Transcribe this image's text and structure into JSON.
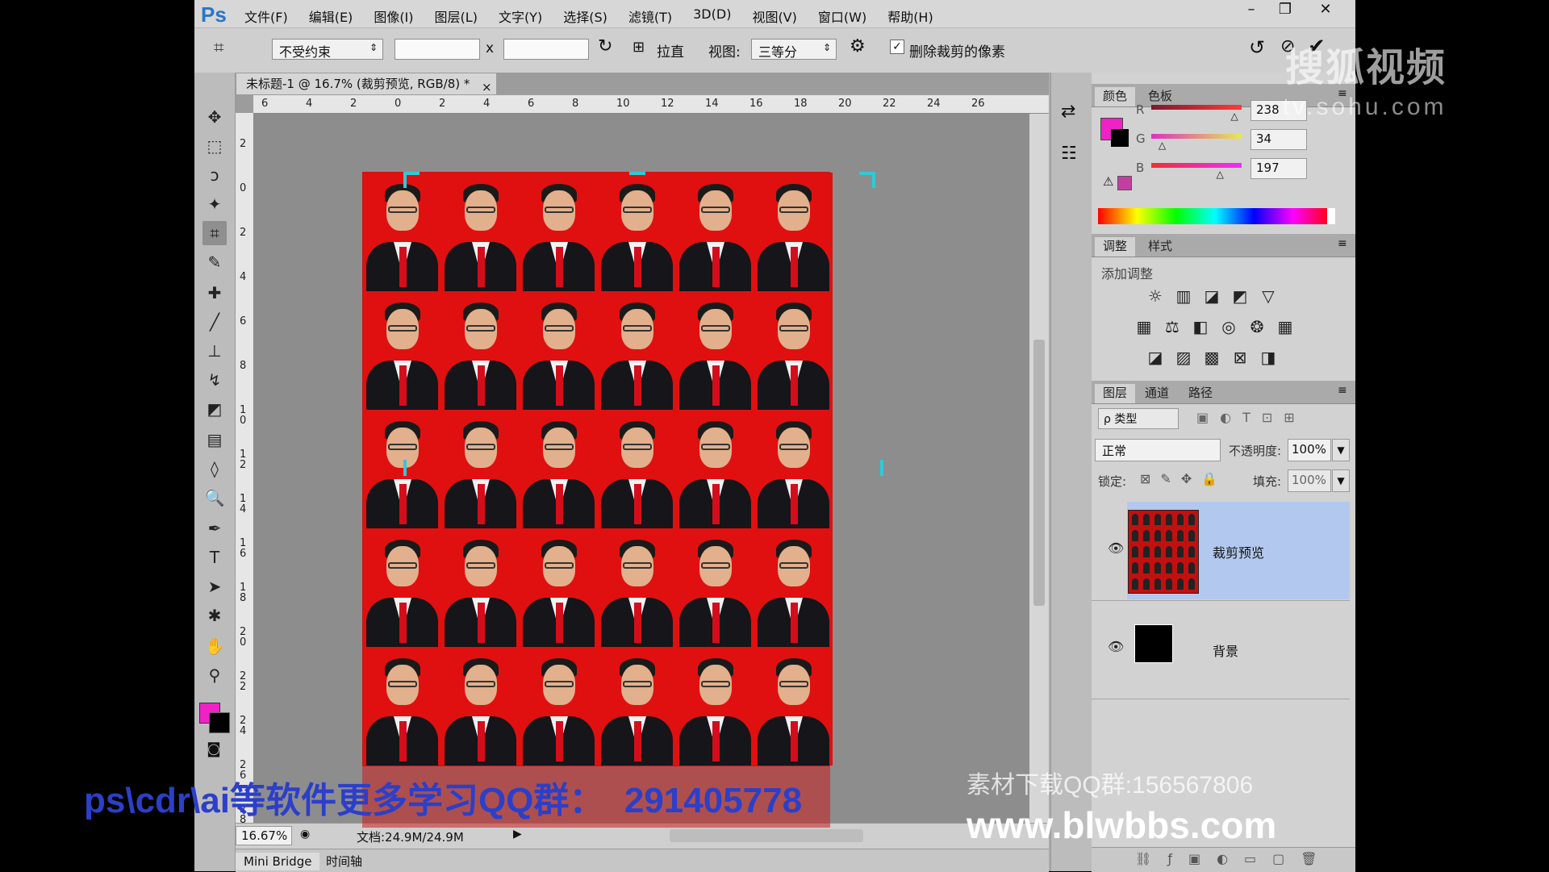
{
  "menu": {
    "logo": "Ps",
    "items": [
      "文件(F)",
      "编辑(E)",
      "图像(I)",
      "图层(L)",
      "文字(Y)",
      "选择(S)",
      "滤镜(T)",
      "3D(D)",
      "视图(V)",
      "窗口(W)",
      "帮助(H)"
    ]
  },
  "window_controls": {
    "minimize": "–",
    "restore": "❐",
    "close": "✕"
  },
  "options": {
    "ratio_select": "不受约束",
    "width_value": "",
    "times": "x",
    "height_value": "",
    "straighten": "拉直",
    "view_label": "视图:",
    "view_select": "三等分",
    "delete_pixels_label": "删除裁剪的像素",
    "delete_pixels_checked": true
  },
  "document": {
    "tab_title": "未标题-1 @ 16.7% (裁剪预览, RGB/8) *",
    "close": "×",
    "ruler_top": [
      "6",
      "4",
      "2",
      "0",
      "2",
      "4",
      "6",
      "8",
      "10",
      "12",
      "14",
      "16",
      "18",
      "20",
      "22",
      "24",
      "26"
    ],
    "ruler_left": [
      "2",
      "0",
      "2",
      "4",
      "6",
      "8",
      "10",
      "12",
      "14",
      "16",
      "18",
      "20",
      "22",
      "24",
      "26",
      "28"
    ],
    "zoom": "16.67%",
    "doc_info": "文档:24.9M/24.9M",
    "bottom_tabs": [
      "Mini Bridge",
      "时间轴"
    ]
  },
  "color_panel": {
    "tabs": [
      "颜色",
      "色板"
    ],
    "foreground": "#ee22c5",
    "background": "#000000",
    "channels": [
      {
        "label": "R",
        "value": "238",
        "fraction": 0.933
      },
      {
        "label": "G",
        "value": "34",
        "fraction": 0.133
      },
      {
        "label": "B",
        "value": "197",
        "fraction": 0.773
      }
    ]
  },
  "adjustments_panel": {
    "tabs": [
      "调整",
      "样式"
    ],
    "title": "添加调整"
  },
  "layers_panel": {
    "tabs": [
      "图层",
      "通道",
      "路径"
    ],
    "filter_label": "ρ 类型",
    "blend_mode": "正常",
    "opacity_label": "不透明度:",
    "opacity_value": "100%",
    "lock_label": "锁定:",
    "fill_label": "填充:",
    "fill_value": "100%",
    "layers": [
      {
        "name": "裁剪预览",
        "selected": true
      },
      {
        "name": "背景",
        "selected": false
      }
    ]
  },
  "overlays": {
    "sohu_logo": "搜狐视频",
    "sohu_url": "tv.sohu.com",
    "bottom_left_text": "ps\\cdr\\ai等软件更多学习QQ群：  291405778",
    "material_qq": "素材下载QQ群:156567806",
    "website": "www.blwbbs.com"
  }
}
